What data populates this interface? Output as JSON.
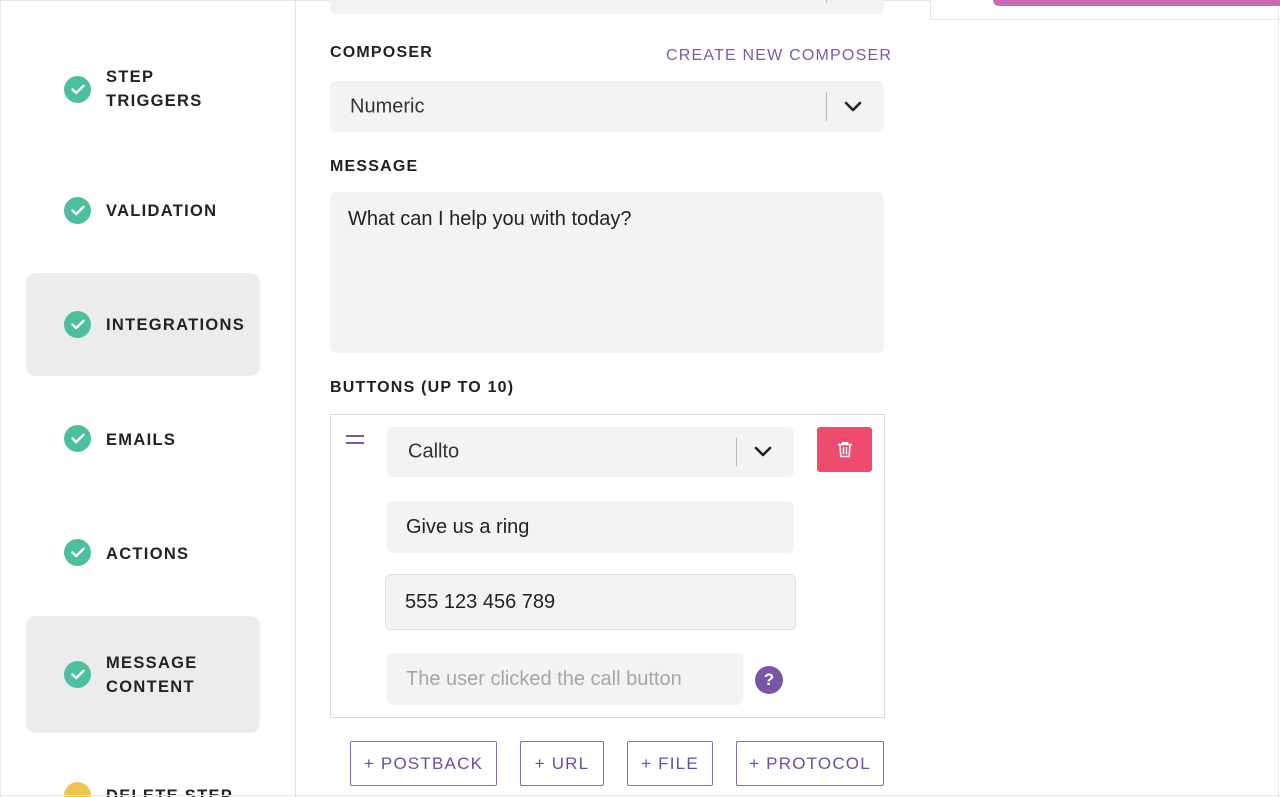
{
  "sidebar": {
    "items": [
      {
        "label": "STEP\nTRIGGERS",
        "status": "complete",
        "active": false
      },
      {
        "label": "VALIDATION",
        "status": "complete",
        "active": false
      },
      {
        "label": "INTEGRATIONS",
        "status": "complete",
        "active": true
      },
      {
        "label": "EMAILS",
        "status": "complete",
        "active": false
      },
      {
        "label": "ACTIONS",
        "status": "complete",
        "active": false
      },
      {
        "label": "MESSAGE\nCONTENT",
        "status": "complete",
        "active": true
      },
      {
        "label": "DELETE STEP",
        "status": "warning",
        "active": false
      }
    ]
  },
  "composer": {
    "label": "COMPOSER",
    "create_link": "CREATE NEW COMPOSER",
    "selected": "Numeric"
  },
  "message": {
    "label": "MESSAGE",
    "value": "What can I help you with today?"
  },
  "buttons": {
    "label": "BUTTONS (UP TO 10)",
    "item": {
      "type": "Callto",
      "text": "Give us a ring",
      "phone": "555 123 456 789",
      "payload_placeholder": "The user clicked the call button",
      "help": "?"
    },
    "add": {
      "postback": "+ POSTBACK",
      "url": "+ URL",
      "file": "+ FILE",
      "protocol": "+ PROTOCOL"
    }
  },
  "colors": {
    "check": "#4cbf9f",
    "warning": "#f1c44f",
    "accent": "#7757a4",
    "danger": "#ee4c6e",
    "active_bg": "#ececed"
  },
  "icons": {
    "check": "check-icon",
    "warning": "warning-icon",
    "chevron": "chevron-down-icon",
    "drag": "drag-handle-icon",
    "trash": "trash-icon",
    "help": "help-icon"
  }
}
